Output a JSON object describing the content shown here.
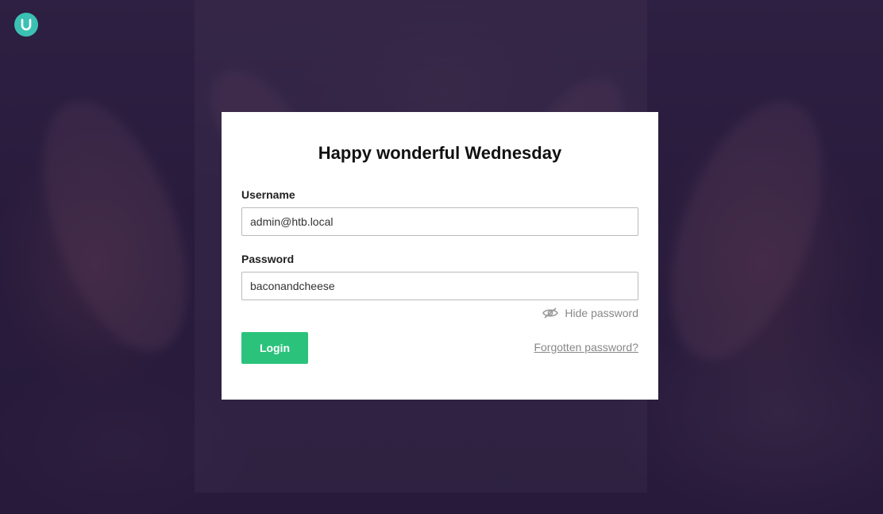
{
  "brand": {
    "logo_icon": "umbraco-logo-icon",
    "accent_color": "#3bc1b3"
  },
  "login": {
    "greeting": "Happy wonderful Wednesday",
    "username": {
      "label": "Username",
      "value": "admin@htb.local"
    },
    "password": {
      "label": "Password",
      "value": "baconandcheese"
    },
    "toggle_password": {
      "label": "Hide password",
      "icon": "eye-slash-icon"
    },
    "login_button": {
      "label": "Login",
      "color": "#2bc37c"
    },
    "forgot_password": "Forgotten password?"
  }
}
